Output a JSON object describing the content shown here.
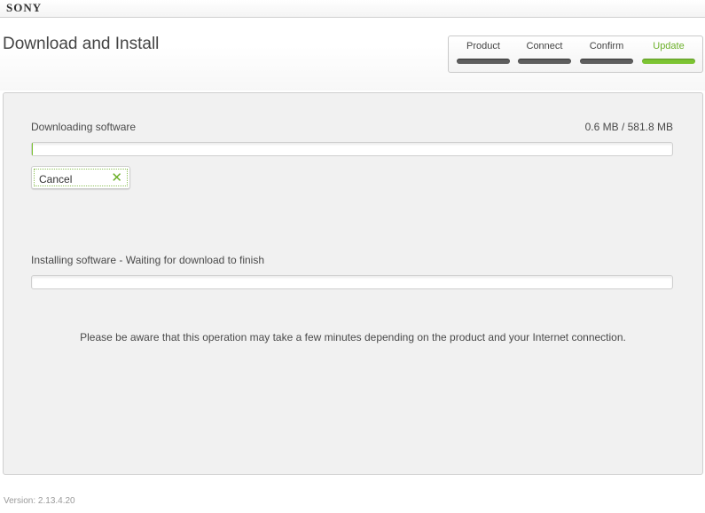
{
  "brand": {
    "name": "SONY"
  },
  "header": {
    "title": "Download and Install"
  },
  "steps": [
    {
      "label": "Product",
      "state": "done"
    },
    {
      "label": "Connect",
      "state": "done"
    },
    {
      "label": "Confirm",
      "state": "done"
    },
    {
      "label": "Update",
      "state": "active"
    }
  ],
  "download": {
    "label": "Downloading software",
    "size_text": "0.6 MB / 581.8 MB",
    "progress_fraction": 0.001
  },
  "cancel_button": {
    "label": "Cancel",
    "icon": "close-icon"
  },
  "install": {
    "label": "Installing software - Waiting for download to finish",
    "progress_fraction": 0
  },
  "notice": "Please be aware that this operation may take a few minutes depending on the product and your Internet connection.",
  "footer": {
    "version": "Version: 2.13.4.20"
  },
  "colors": {
    "accent_green": "#7cc432",
    "step_inactive": "#5e5e5e",
    "panel_bg": "#f1f1f1"
  }
}
